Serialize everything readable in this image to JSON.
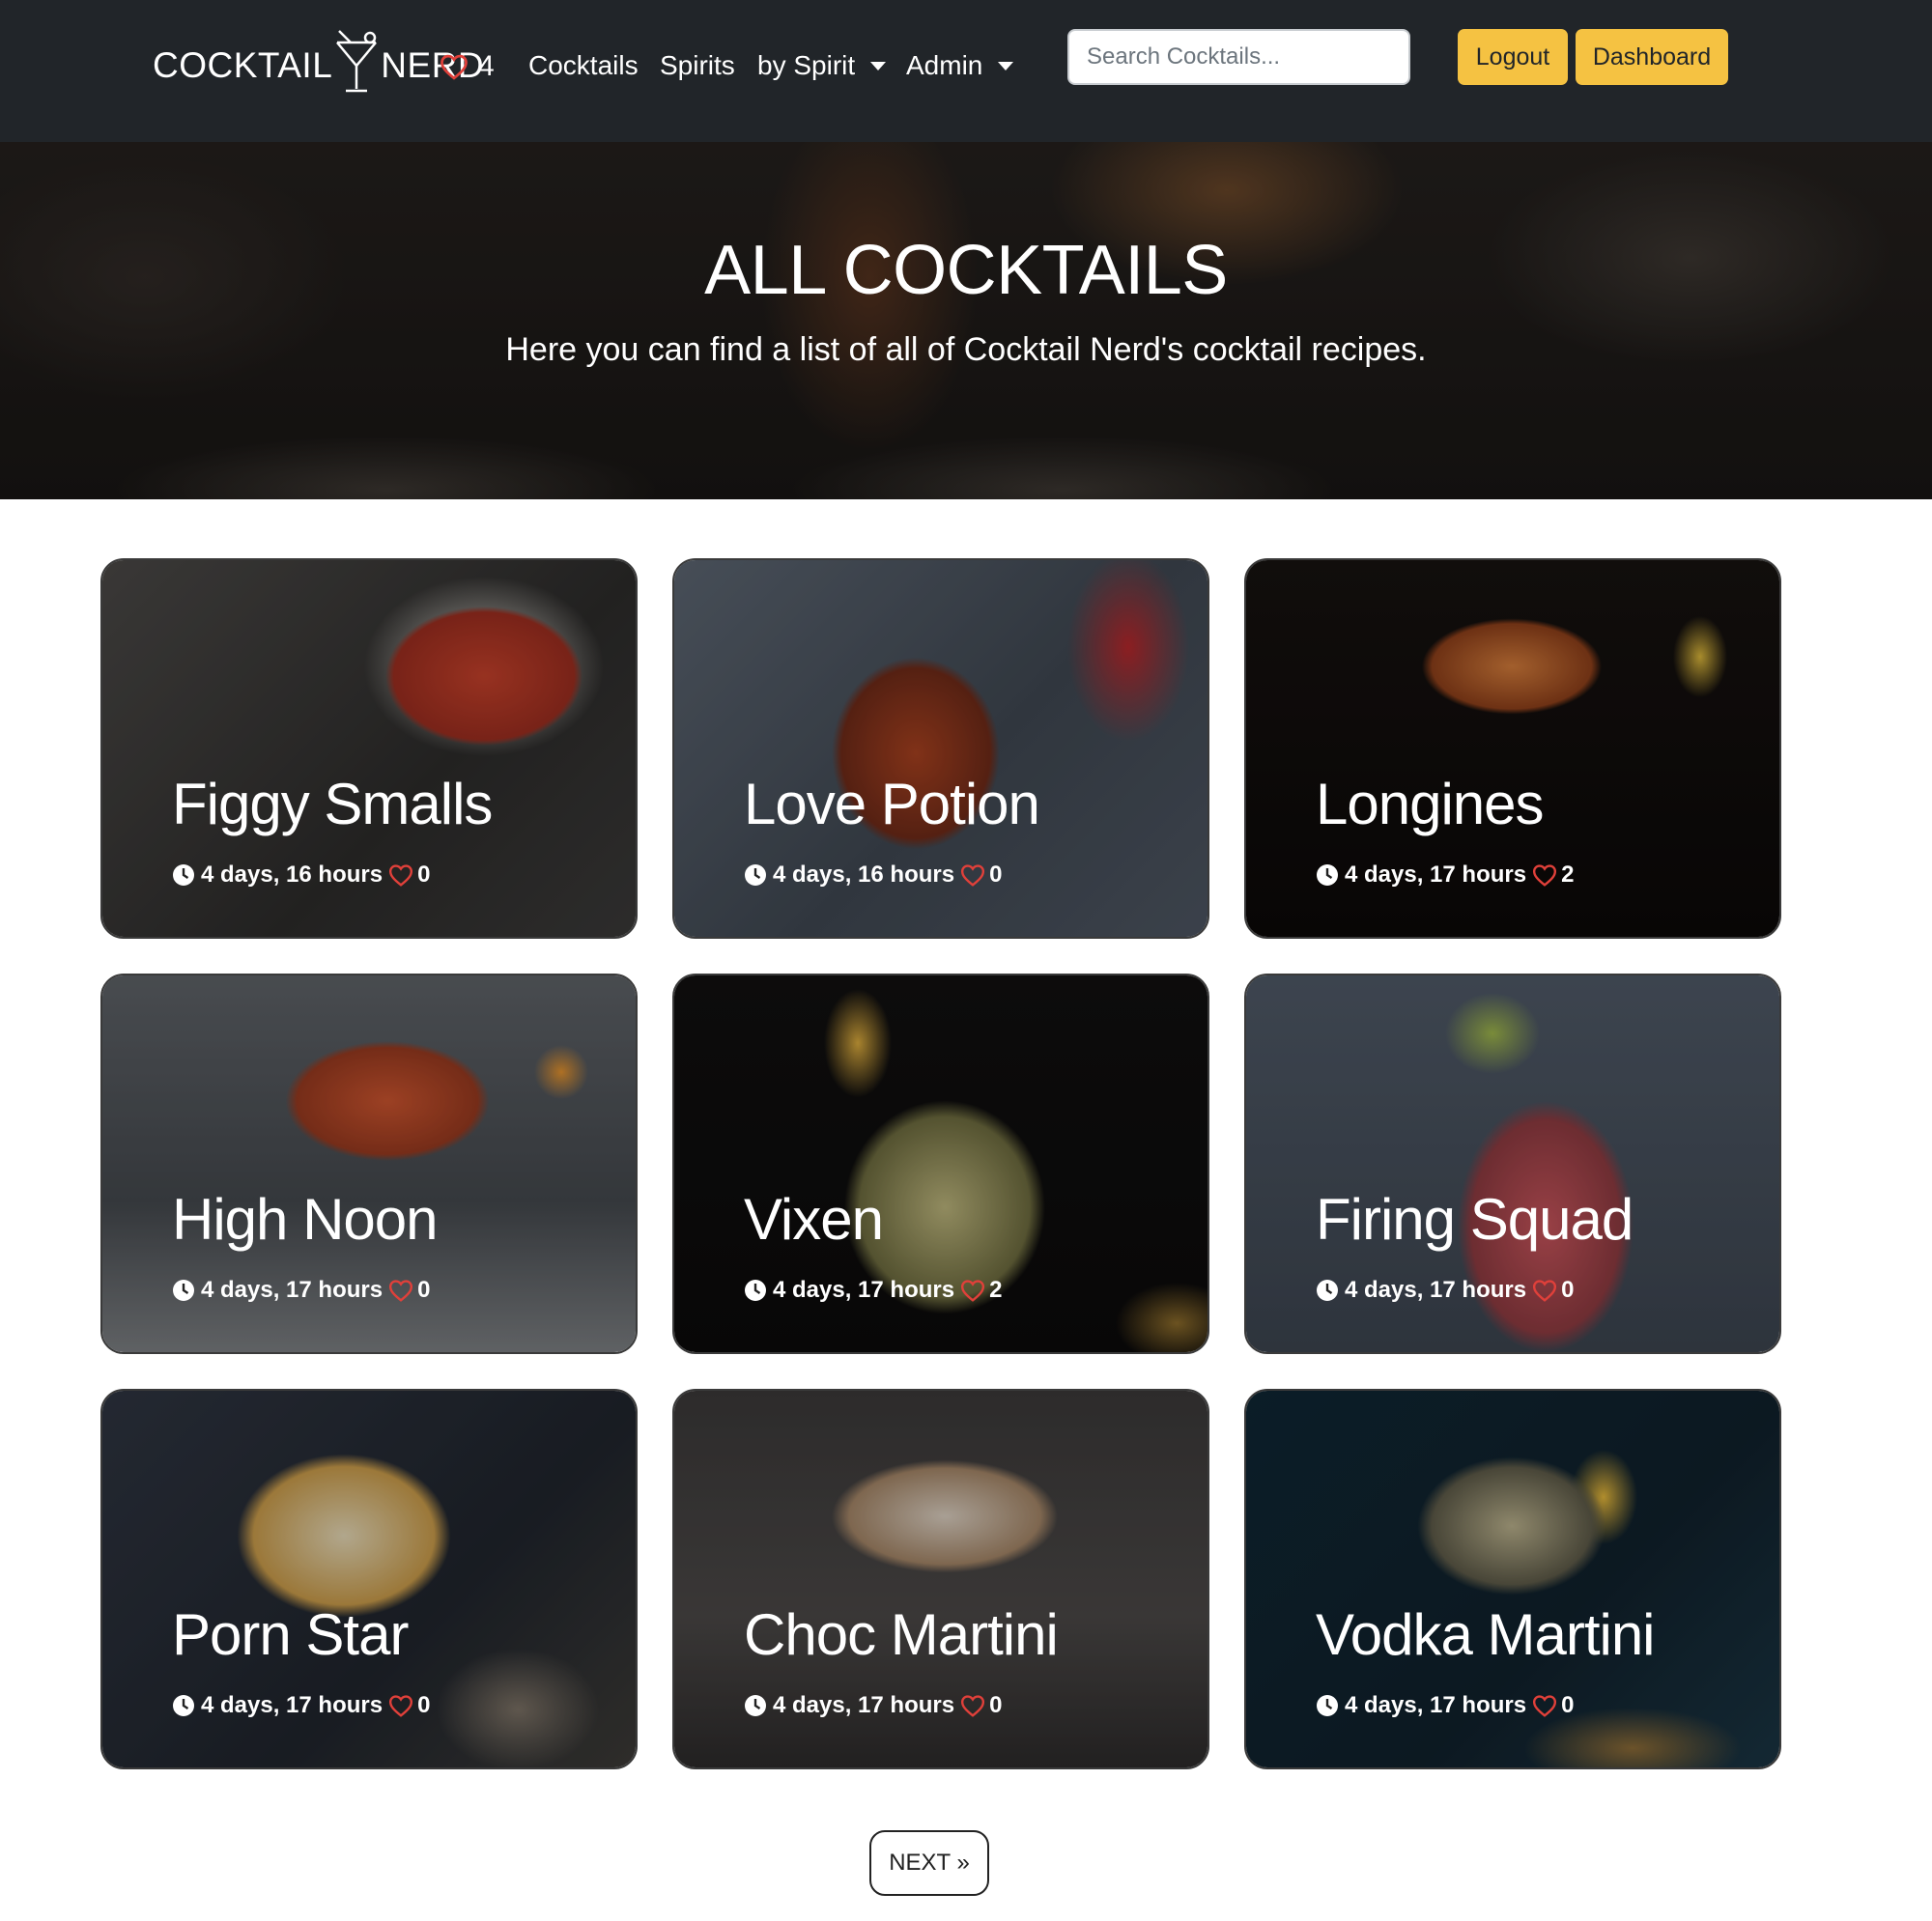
{
  "navbar": {
    "brand_left": "COCKTAIL",
    "brand_right": "NERD",
    "favorites_count": "4",
    "links": {
      "cocktails": "Cocktails",
      "spirits": "Spirits",
      "by_spirit": "by Spirit",
      "admin": "Admin"
    },
    "search_placeholder": "Search Cocktails...",
    "logout": "Logout",
    "dashboard": "Dashboard",
    "accent_color": "#f5c242",
    "heart_color": "#e0403a"
  },
  "hero": {
    "title": "ALL COCKTAILS",
    "subtitle": "Here you can find a list of all of Cocktail Nerd's cocktail recipes."
  },
  "cocktails": [
    {
      "name": "Figgy Smalls",
      "age": "4 days, 16 hours",
      "likes": "0"
    },
    {
      "name": "Love Potion",
      "age": "4 days, 16 hours",
      "likes": "0"
    },
    {
      "name": "Longines",
      "age": "4 days, 17 hours",
      "likes": "2"
    },
    {
      "name": "High Noon",
      "age": "4 days, 17 hours",
      "likes": "0"
    },
    {
      "name": "Vixen",
      "age": "4 days, 17 hours",
      "likes": "2"
    },
    {
      "name": "Firing Squad",
      "age": "4 days, 17 hours",
      "likes": "0"
    },
    {
      "name": "Porn Star",
      "age": "4 days, 17 hours",
      "likes": "0"
    },
    {
      "name": "Choc Martini",
      "age": "4 days, 17 hours",
      "likes": "0"
    },
    {
      "name": "Vodka Martini",
      "age": "4 days, 17 hours",
      "likes": "0"
    }
  ],
  "pagination": {
    "next": "NEXT »"
  }
}
